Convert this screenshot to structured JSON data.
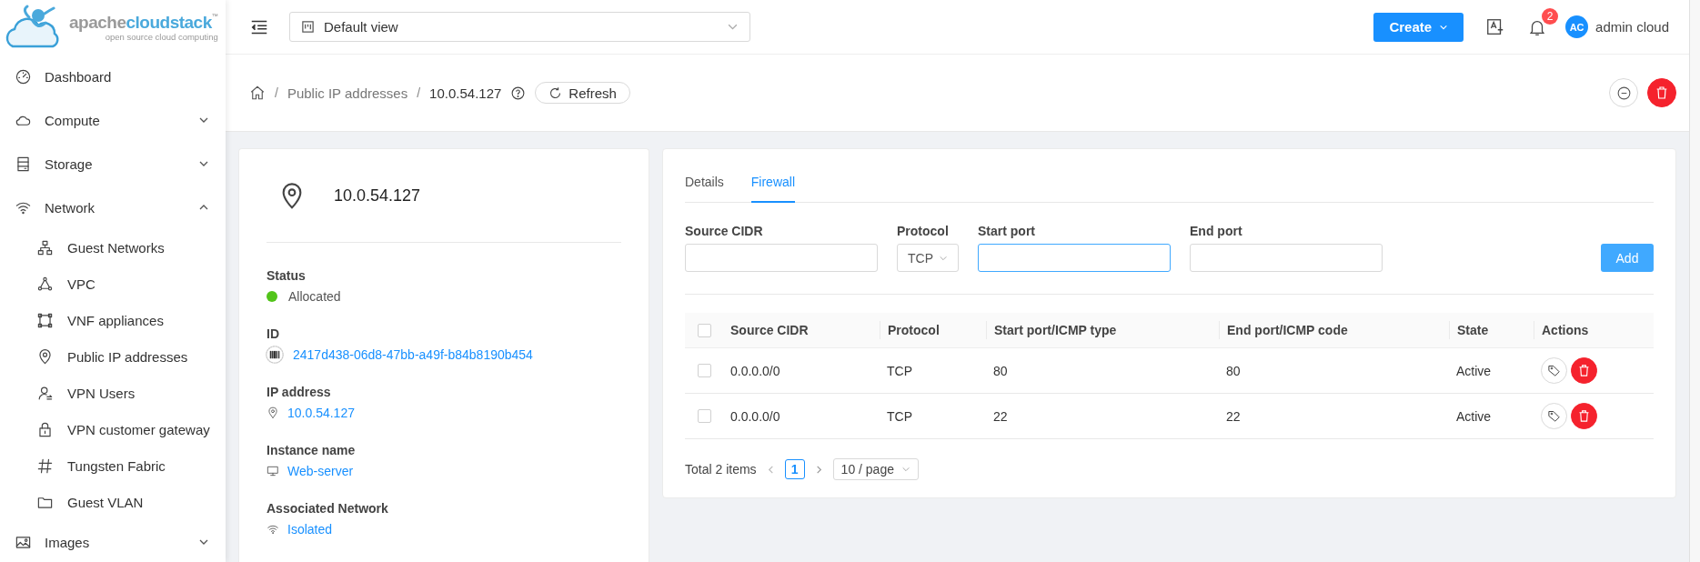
{
  "logo": {
    "prefix": "apache",
    "name": "cloudstack",
    "trademark": "™",
    "tagline": "open source cloud computing"
  },
  "sidebar": {
    "items": [
      {
        "label": "Dashboard"
      },
      {
        "label": "Compute",
        "expanded": false
      },
      {
        "label": "Storage",
        "expanded": false
      },
      {
        "label": "Network",
        "expanded": true,
        "children": [
          {
            "label": "Guest Networks"
          },
          {
            "label": "VPC"
          },
          {
            "label": "VNF appliances"
          },
          {
            "label": "Public IP addresses"
          },
          {
            "label": "VPN Users"
          },
          {
            "label": "VPN customer gateway"
          },
          {
            "label": "Tungsten Fabric"
          },
          {
            "label": "Guest VLAN"
          }
        ]
      },
      {
        "label": "Images",
        "expanded": false
      }
    ]
  },
  "header": {
    "view_select": "Default view",
    "create": "Create",
    "notifications": "2",
    "user": {
      "initials": "AC",
      "name": "admin cloud"
    }
  },
  "breadcrumb": {
    "separator": "/",
    "items": [
      "Public IP addresses",
      "10.0.54.127"
    ],
    "refresh": "Refresh"
  },
  "resource": {
    "title": "10.0.54.127",
    "fields": [
      {
        "label": "Status",
        "kind": "status",
        "value": "Allocated",
        "color": "#52c41a"
      },
      {
        "label": "ID",
        "kind": "link",
        "value": "2417d438-06d8-47bb-a49f-b84b8190b454"
      },
      {
        "label": "IP address",
        "kind": "link",
        "value": "10.0.54.127"
      },
      {
        "label": "Instance name",
        "kind": "link",
        "value": "Web-server"
      },
      {
        "label": "Associated Network",
        "kind": "link",
        "value": "Isolated"
      }
    ]
  },
  "tabs": [
    {
      "label": "Details",
      "selected": false
    },
    {
      "label": "Firewall",
      "selected": true
    }
  ],
  "form": {
    "fields": [
      {
        "label": "Source CIDR",
        "kind": "input",
        "focused": false
      },
      {
        "label": "Protocol",
        "kind": "select",
        "value": "TCP"
      },
      {
        "label": "Start port",
        "kind": "input",
        "focused": true
      },
      {
        "label": "End port",
        "kind": "input",
        "focused": false
      }
    ],
    "add": "Add"
  },
  "table": {
    "header_checked": false,
    "columns": [
      "Source CIDR",
      "Protocol",
      "Start port/ICMP type",
      "End port/ICMP code",
      "State",
      "Actions"
    ],
    "rows": [
      {
        "checked": false,
        "cells": [
          "0.0.0.0/0",
          "TCP",
          "80",
          "80",
          "Active"
        ]
      },
      {
        "checked": false,
        "cells": [
          "0.0.0.0/0",
          "TCP",
          "22",
          "22",
          "Active"
        ]
      }
    ]
  },
  "pagination": {
    "total": "Total 2 items",
    "pages": [
      {
        "label": "1",
        "selected": true
      }
    ],
    "page_size": "10 / page"
  }
}
